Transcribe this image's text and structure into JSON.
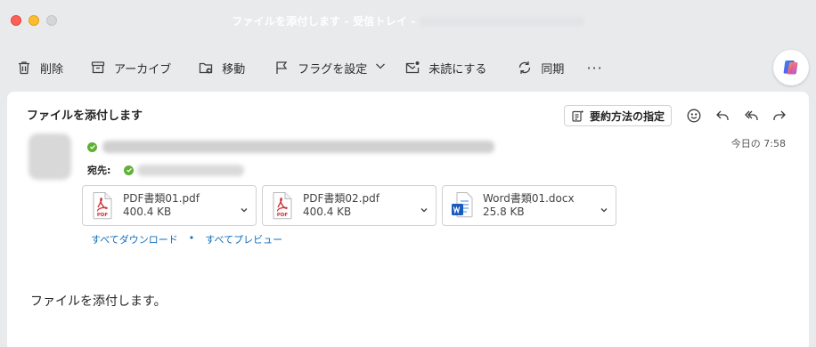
{
  "window": {
    "title": "ファイルを添付します - 受信トレイ -"
  },
  "toolbar": {
    "delete_label": "削除",
    "archive_label": "アーカイブ",
    "move_label": "移動",
    "flag_label": "フラグを設定",
    "unread_label": "未読にする",
    "sync_label": "同期",
    "more_label": "···"
  },
  "message": {
    "subject": "ファイルを添付します",
    "summary_button": "要約方法の指定",
    "to_label": "宛先:",
    "date": "今日の 7:58",
    "body": "ファイルを添付します。"
  },
  "attachments": [
    {
      "name": "PDF書類01.pdf",
      "size": "400.4 KB",
      "type": "pdf"
    },
    {
      "name": "PDF書類02.pdf",
      "size": "400.4 KB",
      "type": "pdf"
    },
    {
      "name": "Word書類01.docx",
      "size": "25.8 KB",
      "type": "word"
    }
  ],
  "links": {
    "download_all": "すべてダウンロード",
    "separator": "•",
    "preview_all": "すべてプレビュー"
  },
  "icons": {
    "pdf_label": "PDF",
    "colors": {
      "pdf_red": "#d13438",
      "word_blue": "#185abd",
      "link_blue": "#0f6cbd",
      "verified_green": "#5fb034"
    }
  }
}
